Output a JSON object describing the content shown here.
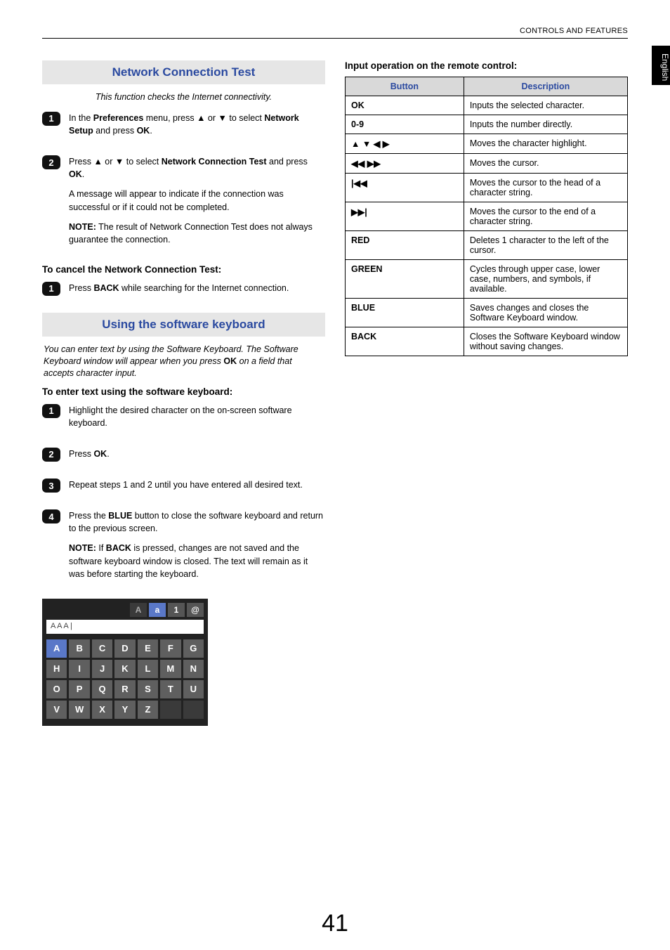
{
  "header": {
    "section_label": "CONTROLS AND FEATURES"
  },
  "side_tab": "English",
  "left": {
    "sec1": {
      "title": "Network Connection Test",
      "intro": "This function checks the Internet connectivity.",
      "step1": {
        "num": "1",
        "text_a": "In the ",
        "pref": "Preferences",
        "text_b": " menu, press ",
        "text_c": " or ",
        "text_d": " to select ",
        "ns": "Network Setup",
        "text_e": " and press ",
        "ok": "OK",
        "text_f": "."
      },
      "step2": {
        "num": "2",
        "text_a": "Press ",
        "text_b": " or ",
        "text_c": " to select ",
        "nct": "Network Connection Test",
        "text_d": " and press ",
        "ok": "OK",
        "text_e": ".",
        "p2": "A message will appear to indicate if the connection was successful or if it could not be completed.",
        "note_label": "NOTE:",
        "note_text": " The result of Network Connection Test does not always guarantee the connection."
      },
      "cancel_hdr": "To cancel the Network Connection Test:",
      "cancel_step": {
        "num": "1",
        "text_a": "Press ",
        "back": "BACK",
        "text_b": " while searching for the Internet connection."
      }
    },
    "sec2": {
      "title": "Using the software keyboard",
      "intro_a": "You can enter text by using the Software Keyboard. The Software Keyboard window will appear when you press ",
      "intro_ok": "OK",
      "intro_b": " on a field that accepts character input.",
      "enter_hdr": "To enter text using the software keyboard:",
      "s1": {
        "num": "1",
        "text": "Highlight the desired character on the on-screen software keyboard."
      },
      "s2": {
        "num": "2",
        "text_a": "Press ",
        "ok": "OK",
        "text_b": "."
      },
      "s3": {
        "num": "3",
        "text": "Repeat steps 1 and 2 until you have entered all desired text."
      },
      "s4": {
        "num": "4",
        "text_a": "Press the ",
        "blue": "BLUE",
        "text_b": " button to close the software keyboard and return to the previous screen.",
        "note_label": "NOTE:",
        "note_text_a": " If ",
        "back": "BACK",
        "note_text_b": " is pressed, changes are not saved and the software keyboard window is closed. The text will remain as it was before starting the keyboard."
      }
    },
    "swkbd": {
      "tabs": [
        "A",
        "a",
        "1",
        "@"
      ],
      "input": "A A A |",
      "rows": [
        [
          "A",
          "B",
          "C",
          "D",
          "E",
          "F",
          "G"
        ],
        [
          "H",
          "I",
          "J",
          "K",
          "L",
          "M",
          "N"
        ],
        [
          "O",
          "P",
          "Q",
          "R",
          "S",
          "T",
          "U"
        ],
        [
          "V",
          "W",
          "X",
          "Y",
          "Z",
          "",
          ""
        ]
      ]
    }
  },
  "right": {
    "heading": "Input operation on the remote control:",
    "th_button": "Button",
    "th_desc": "Description",
    "rows": [
      {
        "btn": "OK",
        "desc": "Inputs the selected character."
      },
      {
        "btn": "0-9",
        "desc": "Inputs the number directly."
      },
      {
        "btn": "▲ ▼ ◀ ▶",
        "arrows": true,
        "desc": "Moves the character highlight."
      },
      {
        "btn": "◀◀ ▶▶",
        "arrows": true,
        "desc": "Moves the cursor."
      },
      {
        "btn": "|◀◀",
        "arrows": true,
        "desc": "Moves the cursor to the head of a character string."
      },
      {
        "btn": "▶▶|",
        "arrows": true,
        "desc": "Moves the cursor to the end of a character string."
      },
      {
        "btn": "RED",
        "desc": "Deletes 1 character to the left of the cursor."
      },
      {
        "btn": "GREEN",
        "desc": "Cycles through upper case, lower case, numbers, and symbols, if available."
      },
      {
        "btn": "BLUE",
        "desc": "Saves changes and closes the Software Keyboard window."
      },
      {
        "btn": "BACK",
        "desc": "Closes the Software Keyboard window without saving changes."
      }
    ]
  },
  "page_number": "41"
}
